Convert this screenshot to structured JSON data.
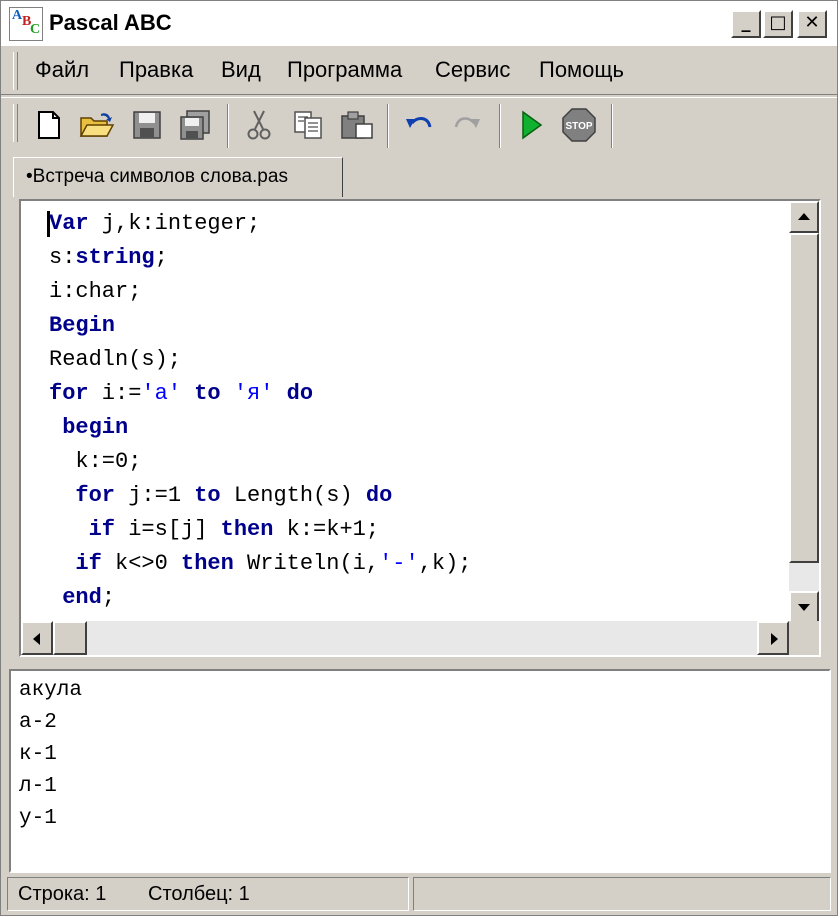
{
  "window": {
    "title": "Pascal ABC"
  },
  "title_buttons": {
    "minimize": "_",
    "maximize": "□",
    "close": "✕"
  },
  "menu": [
    "Файл",
    "Правка",
    "Вид",
    "Программа",
    "Сервис",
    "Помощь"
  ],
  "toolbar_icons": [
    "new-file-icon",
    "open-folder-icon",
    "save-icon",
    "save-all-icon",
    "cut-icon",
    "copy-icon",
    "paste-icon",
    "undo-icon",
    "redo-icon",
    "run-icon",
    "stop-icon"
  ],
  "tab": {
    "label": "•Встреча символов слова.pas"
  },
  "code": [
    [
      {
        "t": "Var",
        "c": "kw"
      },
      {
        "t": " j,k:integer;",
        "c": ""
      }
    ],
    [
      {
        "t": "s:",
        "c": ""
      },
      {
        "t": "string",
        "c": "kw"
      },
      {
        "t": ";",
        "c": ""
      }
    ],
    [
      {
        "t": "i:char;",
        "c": ""
      }
    ],
    [
      {
        "t": "Begin",
        "c": "kw"
      }
    ],
    [
      {
        "t": "Readln(s);",
        "c": ""
      }
    ],
    [
      {
        "t": "for",
        "c": "kw"
      },
      {
        "t": " i:=",
        "c": ""
      },
      {
        "t": "'а'",
        "c": "str"
      },
      {
        "t": " ",
        "c": ""
      },
      {
        "t": "to",
        "c": "kw"
      },
      {
        "t": " ",
        "c": ""
      },
      {
        "t": "'я'",
        "c": "str"
      },
      {
        "t": " ",
        "c": ""
      },
      {
        "t": "do",
        "c": "kw"
      }
    ],
    [
      {
        "t": " ",
        "c": ""
      },
      {
        "t": "begin",
        "c": "kw"
      }
    ],
    [
      {
        "t": "  k:=0;",
        "c": ""
      }
    ],
    [
      {
        "t": "  ",
        "c": ""
      },
      {
        "t": "for",
        "c": "kw"
      },
      {
        "t": " j:=1 ",
        "c": ""
      },
      {
        "t": "to",
        "c": "kw"
      },
      {
        "t": " Length(s) ",
        "c": ""
      },
      {
        "t": "do",
        "c": "kw"
      }
    ],
    [
      {
        "t": "   ",
        "c": ""
      },
      {
        "t": "if",
        "c": "kw"
      },
      {
        "t": " i=s[j] ",
        "c": ""
      },
      {
        "t": "then",
        "c": "kw"
      },
      {
        "t": " k:=k+1;",
        "c": ""
      }
    ],
    [
      {
        "t": "  ",
        "c": ""
      },
      {
        "t": "if",
        "c": "kw"
      },
      {
        "t": " k<>0 ",
        "c": ""
      },
      {
        "t": "then",
        "c": "kw"
      },
      {
        "t": " Writeln(i,",
        "c": ""
      },
      {
        "t": "'-'",
        "c": "str"
      },
      {
        "t": ",k);",
        "c": ""
      }
    ],
    [
      {
        "t": " ",
        "c": ""
      },
      {
        "t": "end",
        "c": "kw"
      },
      {
        "t": ";",
        "c": ""
      }
    ]
  ],
  "output": [
    "акула",
    "а-2",
    "к-1",
    "л-1",
    "у-1"
  ],
  "status": {
    "row": "Строка: 1",
    "col": "Столбец: 1"
  }
}
